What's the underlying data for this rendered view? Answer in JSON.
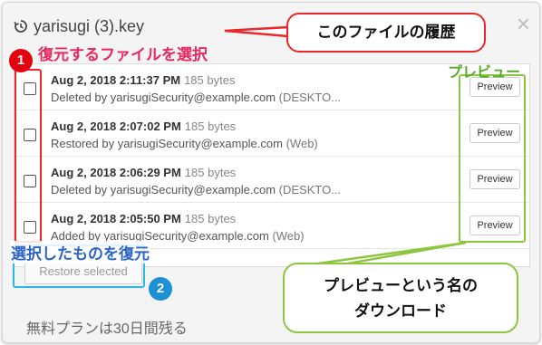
{
  "dialog": {
    "title": "yarisugi (3).key",
    "close_glyph": "×",
    "history_icon": "history-icon"
  },
  "versions": [
    {
      "date": "Aug 2, 2018 2:11:37 PM",
      "size": "185 bytes",
      "action": "Deleted by yarisugiSecurity@example.com",
      "source": "(DESKTO...",
      "preview_label": "Preview"
    },
    {
      "date": "Aug 2, 2018 2:07:02 PM",
      "size": "185 bytes",
      "action": "Restored by yarisugiSecurity@example.com",
      "source": "(Web)",
      "preview_label": "Preview"
    },
    {
      "date": "Aug 2, 2018 2:06:29 PM",
      "size": "185 bytes",
      "action": "Deleted by yarisugiSecurity@example.com",
      "source": "(DESKTO...",
      "preview_label": "Preview"
    },
    {
      "date": "Aug 2, 2018 2:05:50 PM",
      "size": "185 bytes",
      "action": "Added by yarisugiSecurity@example.com",
      "source": "(Web)",
      "preview_label": "Preview"
    }
  ],
  "restore_button": "Restore selected",
  "footer_note": "無料プランは30日間残る",
  "annotations": {
    "callout_history": "このファイルの履歴",
    "label_select": "復元するファイルを選択",
    "label_preview": "プレビュー",
    "label_restore": "選択したものを復元",
    "callout_preview_line1": "プレビューという名の",
    "callout_preview_line2": "ダウンロード",
    "step1": "1",
    "step2": "2",
    "colors": {
      "red": "#e8282a",
      "green": "#8cc63f",
      "blue": "#29b6e8"
    }
  }
}
